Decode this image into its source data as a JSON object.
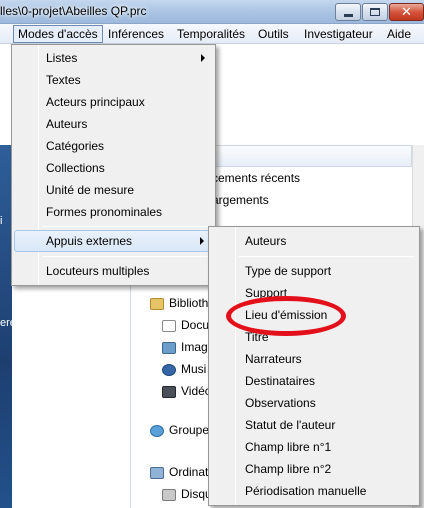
{
  "window": {
    "title": "lles\\0-projet\\Abeilles QP.prc",
    "controls": {
      "minimize": "minimize-button",
      "maximize": "maximize-button",
      "close": "close-button"
    }
  },
  "menubar": {
    "items": [
      "Modes d'accès",
      "Inférences",
      "Temporalités",
      "Outils",
      "Investigateur",
      "Aide"
    ],
    "active": "Modes d'accès"
  },
  "modes_menu": {
    "items": [
      {
        "label": "Listes",
        "submenu": true
      },
      {
        "label": "Textes"
      },
      {
        "label": "Acteurs principaux"
      },
      {
        "label": "Auteurs"
      },
      {
        "label": "Catégories"
      },
      {
        "label": "Collections"
      },
      {
        "label": "Unité de mesure"
      },
      {
        "label": "Formes pronominales"
      },
      {
        "label": "Appuis externes",
        "submenu": true,
        "highlighted": true
      },
      {
        "label": "Locuteurs multiples"
      }
    ]
  },
  "appuis_submenu": {
    "items": [
      "Auteurs",
      "Type de support",
      "Support",
      "Lieu d'émission",
      "Titre",
      "Narrateurs",
      "Destinataires",
      "Observations",
      "Statut de l'auteur",
      "Champ libre n°1",
      "Champ libre n°2",
      "Périodisation manuelle"
    ],
    "circled": "Lieu d'émission"
  },
  "background": {
    "desktop_texts": [
      "i",
      "ere..."
    ],
    "list_texts": [
      "cements récents",
      "argements",
      "Biblioth",
      "Docu",
      "Imag",
      "Musi",
      "Vidéc",
      "Groupe",
      "Ordinat",
      "Disqu"
    ]
  },
  "colors": {
    "annotation": "#e3101c",
    "menu_highlight": "#d9e7f7",
    "titlebar": "#a9c3e3"
  }
}
